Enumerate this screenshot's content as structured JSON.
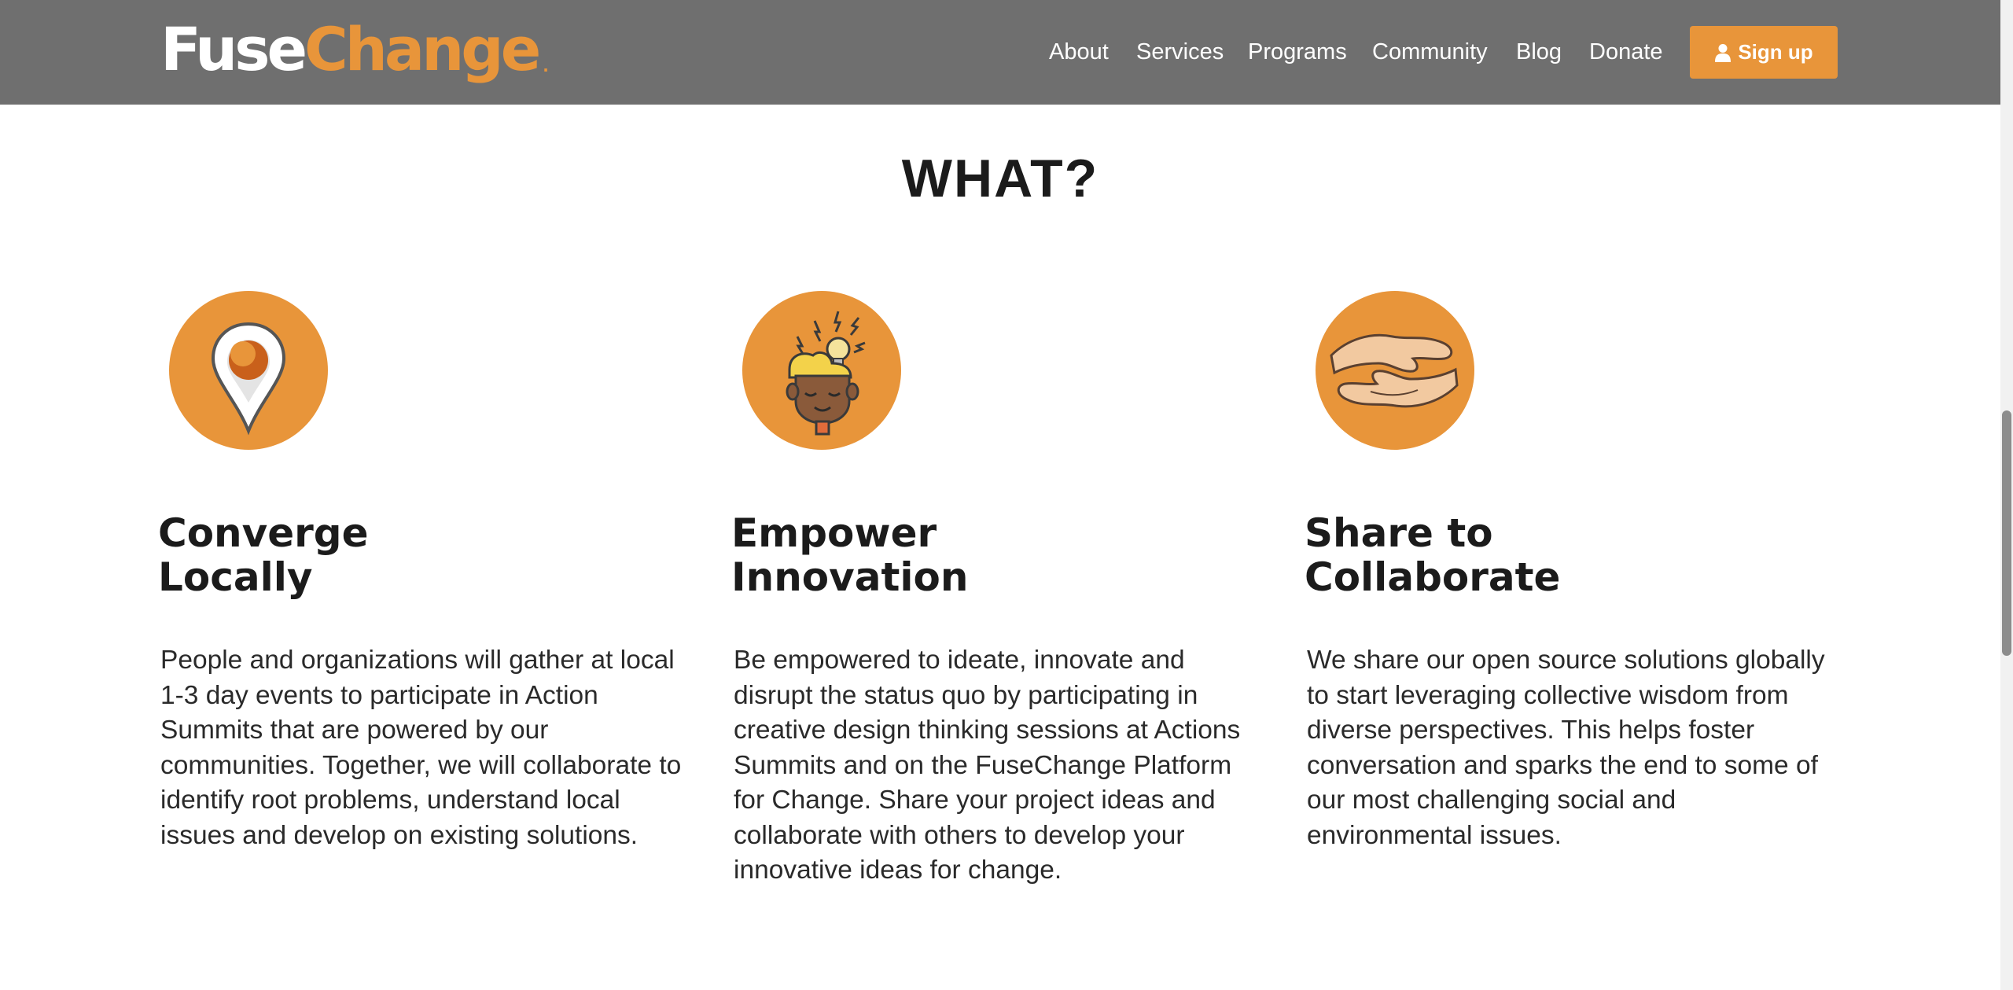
{
  "header": {
    "logo": {
      "part1": "Fuse",
      "part2": "Change",
      "mark": "."
    },
    "nav": [
      {
        "label": "About"
      },
      {
        "label": "Services"
      },
      {
        "label": "Programs"
      },
      {
        "label": "Community"
      },
      {
        "label": "Blog"
      },
      {
        "label": "Donate"
      }
    ],
    "signup": {
      "label": "Sign up",
      "icon": "user-icon"
    }
  },
  "section": {
    "title": "WHAT?",
    "columns": [
      {
        "icon": "location-pin-icon",
        "title_line1": "Converge",
        "title_line2": "Locally",
        "text": "People and organizations will gather at local 1-3 day events to participate in Action Summits that are powered by our communities. Together, we will collaborate to identify root problems, understand local issues and develop on existing solutions."
      },
      {
        "icon": "idea-head-icon",
        "title_line1": "Empower",
        "title_line2": "Innovation",
        "text": "Be empowered to ideate, innovate and disrupt the status quo by participating in creative design thinking sessions at Actions Summits and on the FuseChange Platform for Change. Share your project ideas and collaborate with others to develop your innovative ideas for change."
      },
      {
        "icon": "cupped-hands-icon",
        "title_line1": "Share to",
        "title_line2": "Collaborate",
        "text": "We share our open source solutions globally to start leveraging collective wisdom from diverse perspectives. This helps foster conversation and sparks the end to some of our most challenging social and environmental issues."
      }
    ]
  },
  "colors": {
    "accent": "#e8953a",
    "header_bg": "#6f6f6f",
    "text": "#1b1b1b"
  }
}
